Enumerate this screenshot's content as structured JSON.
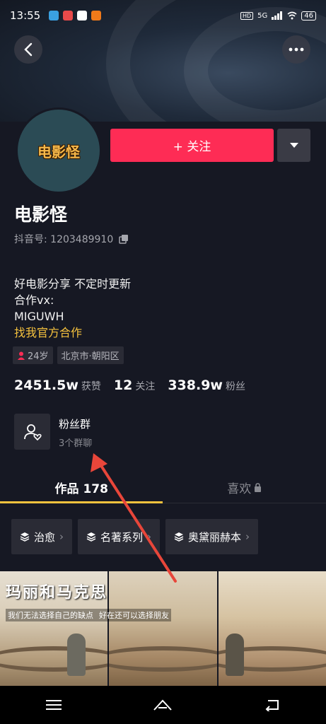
{
  "status_bar": {
    "time": "13:55",
    "network": "5G",
    "battery": "46"
  },
  "profile": {
    "avatar_text": "电影怪",
    "follow_label": "+ 关注",
    "name": "电影怪",
    "douyin_id": "抖音号: 1203489910",
    "bio_lines": [
      "好电影分享 不定时更新",
      "合作vx:",
      "MIGUWH"
    ],
    "bio_accent": "找我官方合作",
    "tags": {
      "age": "24岁",
      "location": "北京市·朝阳区"
    },
    "stats": {
      "likes_value": "2451.5w",
      "likes_label": "获赞",
      "following_value": "12",
      "following_label": "关注",
      "fans_value": "338.9w",
      "fans_label": "粉丝"
    },
    "fan_group": {
      "title": "粉丝群",
      "subtitle": "3个群聊"
    }
  },
  "tabs": {
    "works": "作品 178",
    "likes": "喜欢"
  },
  "collections": [
    "治愈",
    "名著系列",
    "奥黛丽赫本"
  ],
  "video": {
    "title": "玛丽和马克思",
    "subtitle_left": "我们无法选择自己的缺点",
    "subtitle_right": "好在还可以选择朋友"
  },
  "colors": {
    "accent_red": "#fe2c55",
    "accent_yellow": "#f6c23e",
    "background": "#161823",
    "annotation_arrow": "#e8463a"
  }
}
